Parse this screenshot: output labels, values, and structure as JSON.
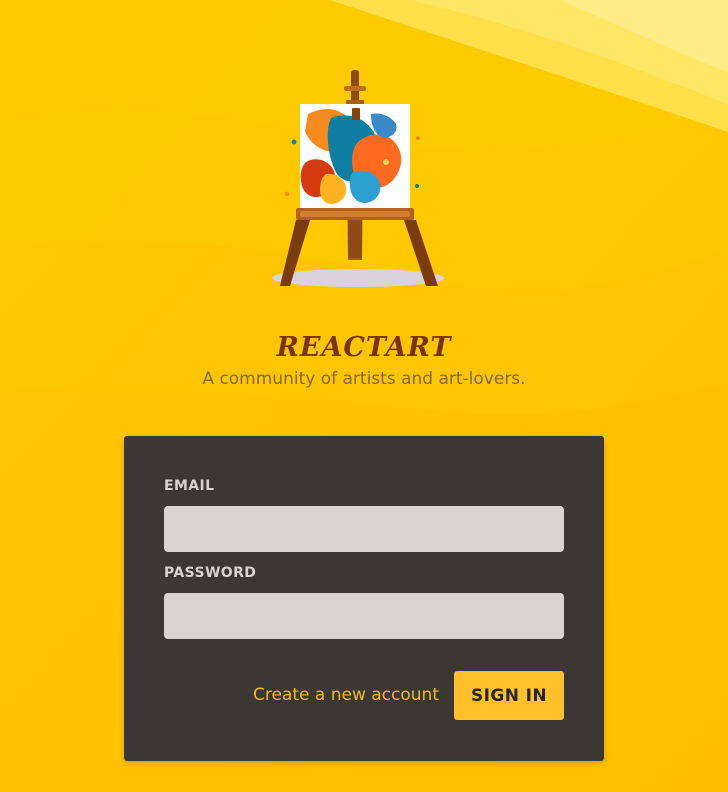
{
  "app": {
    "brand_name": "REACTART",
    "tagline": "A community of artists and art-lovers.",
    "colors": {
      "background": "#ffc300",
      "background_light": "#ffe24a",
      "brand_text": "#7a3307",
      "card": "#3a3735",
      "input": "#d7d4d1",
      "accent": "#ffc02a",
      "link": "#f0b824"
    }
  },
  "hero": {
    "illustration": "easel-painting-illustration"
  },
  "login": {
    "email_label": "EMAIL",
    "email_value": "",
    "password_label": "PASSWORD",
    "password_value": "",
    "create_account_label": "Create a new account",
    "sign_in_label": "SIGN IN"
  }
}
